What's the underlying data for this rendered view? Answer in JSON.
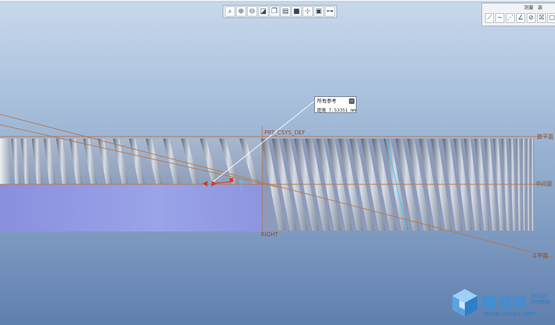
{
  "view_toolbar": {
    "buttons": [
      {
        "name": "refit-icon",
        "glyph": "⌕"
      },
      {
        "name": "zoom-in-icon",
        "glyph": "⊕"
      },
      {
        "name": "zoom-out-icon",
        "glyph": "⊖"
      },
      {
        "name": "repaint-icon",
        "glyph": "◪"
      },
      {
        "name": "reorient-icon",
        "glyph": "❐"
      },
      {
        "name": "saved-views-icon",
        "glyph": "▤"
      },
      {
        "name": "display-style-icon",
        "glyph": "■"
      },
      {
        "name": "datum-display-icon",
        "glyph": "⊹"
      },
      {
        "name": "plane-display-icon",
        "glyph": "▣"
      },
      {
        "name": "csys-display-icon",
        "glyph": "⊶"
      }
    ]
  },
  "right_panel": {
    "label_1": "测量",
    "label_2": "装",
    "tools": [
      {
        "name": "length-measure-icon",
        "glyph": "⟋"
      },
      {
        "name": "curve-icon",
        "glyph": "∼"
      },
      {
        "name": "distance-measure-icon",
        "glyph": "⋰"
      },
      {
        "name": "angle-measure-icon",
        "glyph": "∠"
      },
      {
        "name": "diameter-measure-icon",
        "glyph": "⊘"
      },
      {
        "name": "area-measure-icon",
        "glyph": "⛝"
      },
      {
        "name": "volume-measure-icon",
        "glyph": "▢"
      }
    ]
  },
  "datums": {
    "csys": "PRT_CSYS_DEF",
    "right": "RIGHT",
    "top_plane": "旋平面",
    "mid_plane": "中间面",
    "bottom_plane": "斗平面"
  },
  "callout": {
    "title": "所有参考",
    "label": "距离",
    "value": "7.53351",
    "unit": "mm"
  },
  "watermark": {
    "brand": "精诚网",
    "tag_line_1": "3D设计",
    "tag_line_2": "网络教程",
    "url": "www.ucegu.com"
  }
}
